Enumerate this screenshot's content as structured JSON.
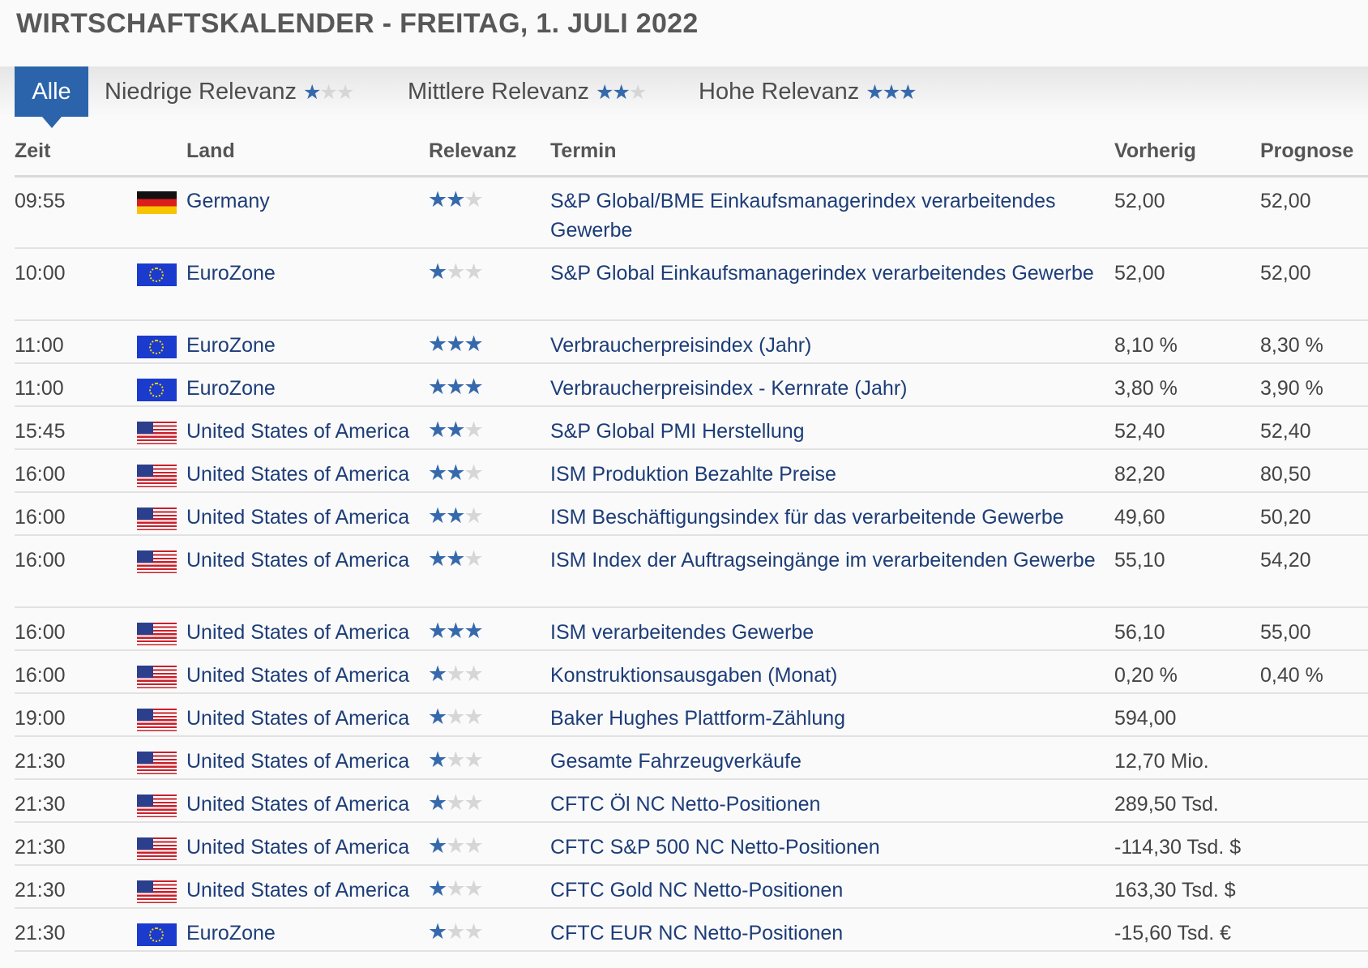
{
  "title": "WIRTSCHAFTSKALENDER - FREITAG, 1. JULI 2022",
  "filters": [
    {
      "label": "Alle",
      "active": true,
      "stars": 0
    },
    {
      "label": "Niedrige Relevanz",
      "active": false,
      "stars": 1
    },
    {
      "label": "Mittlere Relevanz",
      "active": false,
      "stars": 2
    },
    {
      "label": "Hohe Relevanz",
      "active": false,
      "stars": 3
    }
  ],
  "columns": {
    "time": "Zeit",
    "country": "Land",
    "relevance": "Relevanz",
    "event": "Termin",
    "previous": "Vorherig",
    "forecast": "Prognose"
  },
  "colors": {
    "accent": "#2b64ab",
    "star_on": "#3569ab",
    "star_off": "#d6d6d6",
    "link": "#1d3d78"
  },
  "rows": [
    {
      "time": "09:55",
      "flag": "germany-flag",
      "country": "Germany",
      "stars": 2,
      "event": "S&P Global/BME Einkaufsmanagerindex verarbeitendes Gewerbe",
      "previous": "52,00",
      "forecast": "52,00"
    },
    {
      "time": "10:00",
      "flag": "eurozone-flag",
      "country": "EuroZone",
      "stars": 1,
      "event": "S&P Global Einkaufsmanagerindex verarbeitendes Gewerbe",
      "previous": "52,00",
      "forecast": "52,00"
    },
    {
      "time": "11:00",
      "flag": "eurozone-flag",
      "country": "EuroZone",
      "stars": 3,
      "event": "Verbraucherpreisindex (Jahr)",
      "previous": "8,10 %",
      "forecast": "8,30 %"
    },
    {
      "time": "11:00",
      "flag": "eurozone-flag",
      "country": "EuroZone",
      "stars": 3,
      "event": "Verbraucherpreisindex - Kernrate (Jahr)",
      "previous": "3,80 %",
      "forecast": "3,90 %"
    },
    {
      "time": "15:45",
      "flag": "usa-flag",
      "country": "United States of America",
      "stars": 2,
      "event": "S&P Global PMI Herstellung",
      "previous": "52,40",
      "forecast": "52,40"
    },
    {
      "time": "16:00",
      "flag": "usa-flag",
      "country": "United States of America",
      "stars": 2,
      "event": "ISM Produktion Bezahlte Preise",
      "previous": "82,20",
      "forecast": "80,50"
    },
    {
      "time": "16:00",
      "flag": "usa-flag",
      "country": "United States of America",
      "stars": 2,
      "event": "ISM Beschäftigungsindex für das verarbeitende Gewerbe",
      "previous": "49,60",
      "forecast": "50,20"
    },
    {
      "time": "16:00",
      "flag": "usa-flag",
      "country": "United States of America",
      "stars": 2,
      "event": "ISM Index der Auftragseingänge im verarbeitenden Gewerbe",
      "previous": "55,10",
      "forecast": "54,20"
    },
    {
      "time": "16:00",
      "flag": "usa-flag",
      "country": "United States of America",
      "stars": 3,
      "event": "ISM verarbeitendes Gewerbe",
      "previous": "56,10",
      "forecast": "55,00"
    },
    {
      "time": "16:00",
      "flag": "usa-flag",
      "country": "United States of America",
      "stars": 1,
      "event": "Konstruktionsausgaben (Monat)",
      "previous": "0,20 %",
      "forecast": "0,40 %"
    },
    {
      "time": "19:00",
      "flag": "usa-flag",
      "country": "United States of America",
      "stars": 1,
      "event": "Baker Hughes Plattform-Zählung",
      "previous": "594,00",
      "forecast": ""
    },
    {
      "time": "21:30",
      "flag": "usa-flag",
      "country": "United States of America",
      "stars": 1,
      "event": "Gesamte Fahrzeugverkäufe",
      "previous": "12,70 Mio.",
      "forecast": ""
    },
    {
      "time": "21:30",
      "flag": "usa-flag",
      "country": "United States of America",
      "stars": 1,
      "event": "CFTC Öl NC Netto-Positionen",
      "previous": "289,50 Tsd.",
      "forecast": ""
    },
    {
      "time": "21:30",
      "flag": "usa-flag",
      "country": "United States of America",
      "stars": 1,
      "event": "CFTC S&P 500 NC Netto-Positionen",
      "previous": "-114,30 Tsd. $",
      "forecast": ""
    },
    {
      "time": "21:30",
      "flag": "usa-flag",
      "country": "United States of America",
      "stars": 1,
      "event": "CFTC Gold NC Netto-Positionen",
      "previous": "163,30 Tsd. $",
      "forecast": ""
    },
    {
      "time": "21:30",
      "flag": "eurozone-flag",
      "country": "EuroZone",
      "stars": 1,
      "event": "CFTC EUR NC Netto-Positionen",
      "previous": "-15,60 Tsd. €",
      "forecast": ""
    }
  ]
}
